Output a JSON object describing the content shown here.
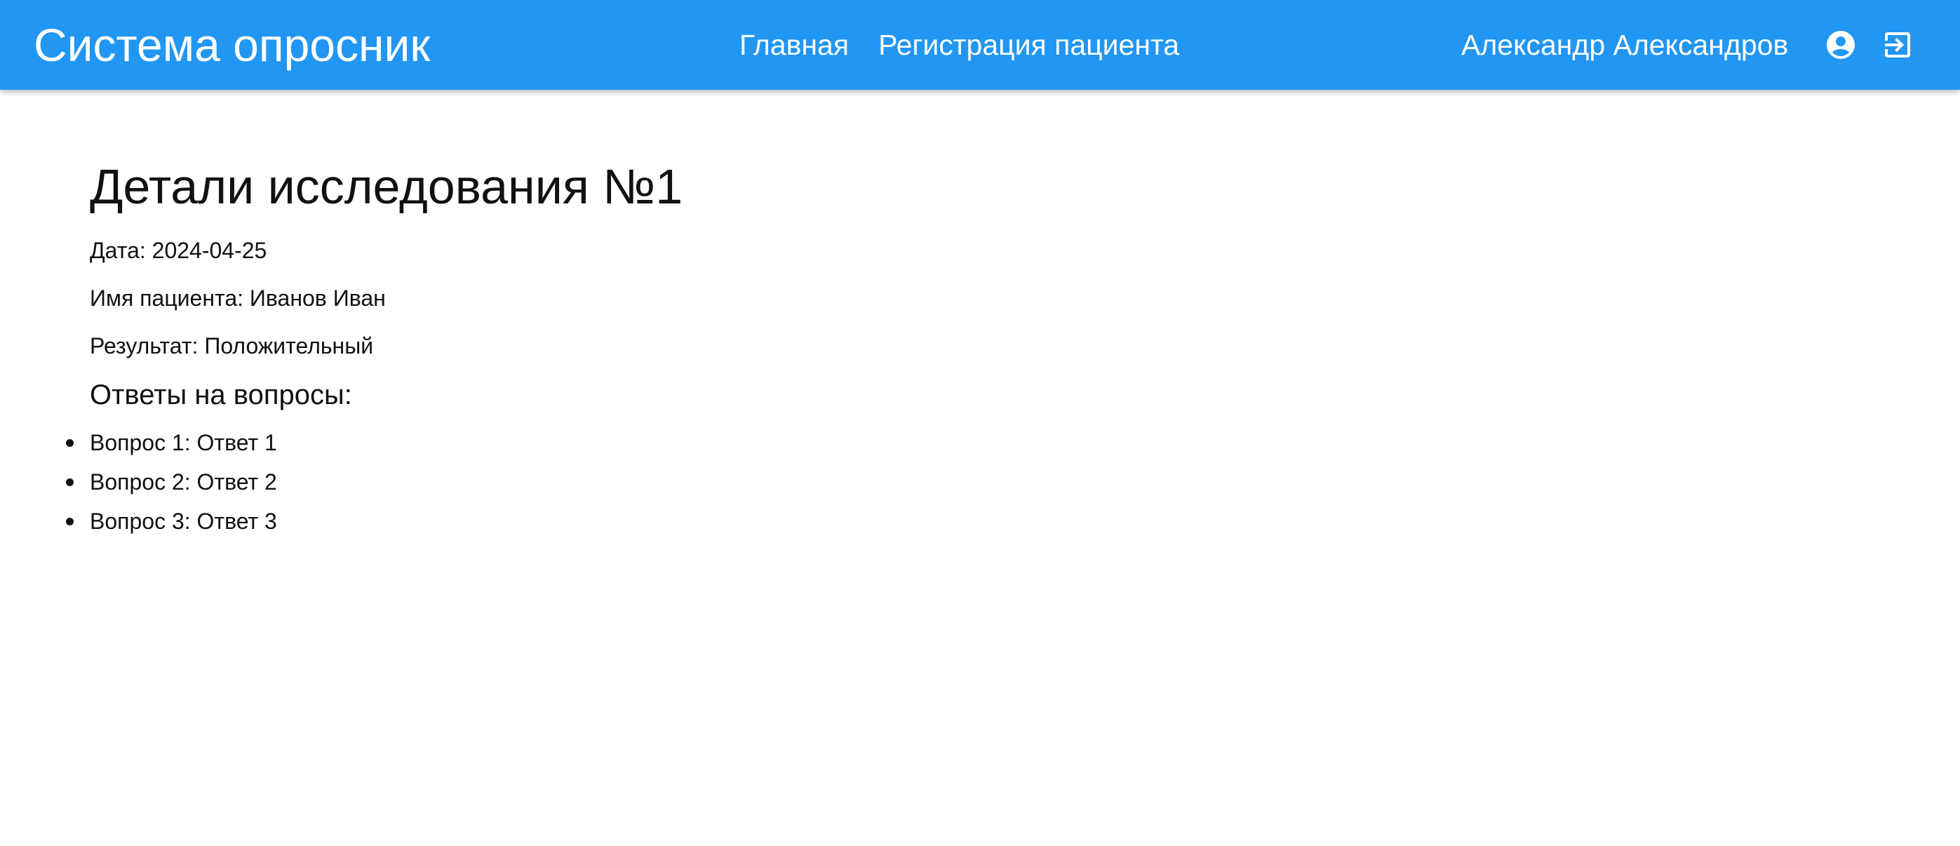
{
  "header": {
    "brand": "Система опросник",
    "nav": [
      {
        "label": "Главная"
      },
      {
        "label": "Регистрация пациента"
      }
    ],
    "user_name": "Александр Александров",
    "account_icon": "account-circle-icon",
    "logout_icon": "logout-icon",
    "accent_color": "#2196f3"
  },
  "main": {
    "title": "Детали исследования №1",
    "date_line": "Дата: 2024-04-25",
    "patient_line": "Имя пациента: Иванов Иван",
    "result_line": "Результат: Положительный",
    "answers_heading": "Ответы на вопросы:",
    "answers": [
      {
        "text": "Вопрос 1: Ответ 1"
      },
      {
        "text": "Вопрос 2: Ответ 2"
      },
      {
        "text": "Вопрос 3: Ответ 3"
      }
    ]
  }
}
